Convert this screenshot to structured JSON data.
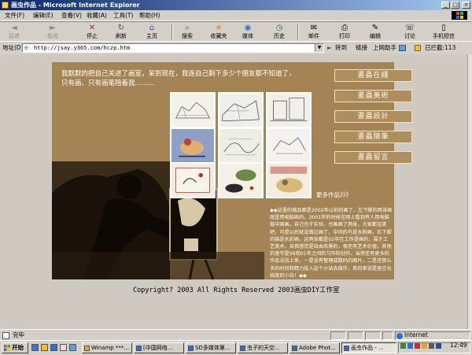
{
  "window": {
    "title": "画虫作品 - Microsoft Internet Explorer",
    "minimize_glyph": "_",
    "maximize_glyph": "□",
    "close_glyph": "×"
  },
  "menu": [
    "文件(F)",
    "编辑(E)",
    "查看(V)",
    "收藏(A)",
    "工具(T)",
    "帮助(H)"
  ],
  "toolbar": {
    "back": "后退",
    "forward": "前进",
    "stop": "停止",
    "refresh": "刷新",
    "home": "主页",
    "search": "搜索",
    "favorites": "收藏夹",
    "media": "媒体",
    "history": "历史",
    "mail": "邮件",
    "print": "打印",
    "edit": "编辑",
    "discuss": "讨论",
    "sms": "手机短信",
    "icons": {
      "back": "◄",
      "forward": "►",
      "stop": "✕",
      "refresh": "↻",
      "home": "⌂",
      "search": "⌕",
      "favorites": "★",
      "media": "◉",
      "history": "◷",
      "mail": "✉",
      "print": "⎙",
      "edit": "✎",
      "discuss": "☏",
      "sms": "▯"
    }
  },
  "address_bar": {
    "label": "地址(D)",
    "url": "http://jsay.y365.com/hczp.htm",
    "dropdown_glyph": "▼",
    "go_label": "转到",
    "links_label": "链接",
    "online_label": "上网助手",
    "blocked_label": "已拦截:113",
    "go_icon": "►"
  },
  "page": {
    "intro": "我默默的把自己关进了画室，呆到现在，我连自己剩下多少个朋友都不知道了，只有画、只有画笔陪着我.........",
    "nav_items": [
      "畫蟲在綫",
      "畫蟲美術",
      "畫蟲設計",
      "畫蟲隨筆",
      "畫蟲留言"
    ],
    "more_link": "更多作品》》》",
    "description": "◆◆这里的做品都是2002年以前的画了，左下脚的两张画既是用电脑画的，2001年的时候在网上看到有人用电脑做中国画，自己也于实验，也画画了两张，大家都见笑吧，可是以后就没做过画了，中间的鸟是水粉画，右下脚的猫是水彩画，这两张都是02年在工作是画的，属于工艺美术，自我感觉是自由风景的，很还有艺术价值，其他的速写是99到01年之间的习作和创作，当然还有更多的作品没放上来，一是没有整理成数码的图片，二是还那么多的时间和精力投入这个小站去做作，希的来说是留言光临我的小站！◆◆",
    "copyright": "Copyright? 2003 All Rights Reserved 2003画虫DIY工作室"
  },
  "status": {
    "text": "完毕",
    "zone": "Internet"
  },
  "taskbar": {
    "start": "开始",
    "tasks": [
      "Winamp ***...",
      "[中国网络...",
      "SD多媒体第...",
      "虫子的天空...",
      "Adobe Phot...",
      "画虫作品 - ..."
    ],
    "active_index": 5,
    "clock": "12:49"
  }
}
